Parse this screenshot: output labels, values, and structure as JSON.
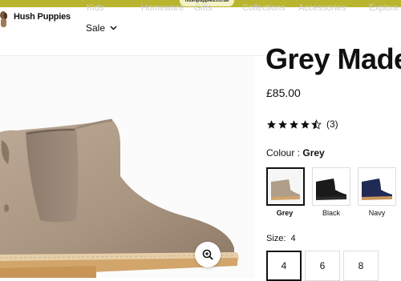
{
  "browser": {
    "url": "hushpuppies.co.uk"
  },
  "header": {
    "brand": "Hush Puppies",
    "nav_ghost": [
      "Kids",
      "Homeware",
      "Gifts",
      "Collections",
      "Accessories",
      "Explore"
    ],
    "sale_label": "Sale"
  },
  "product": {
    "title": "Grey Made",
    "price": "£85.00",
    "rating": {
      "stars": 4.5,
      "count": "(3)"
    },
    "colour": {
      "label": "Colour :",
      "selected": "Grey",
      "options": [
        {
          "name": "Grey",
          "color": "#b09d8a"
        },
        {
          "name": "Black",
          "color": "#1a1a1a"
        },
        {
          "name": "Navy",
          "color": "#1f2a55"
        }
      ]
    },
    "size": {
      "label": "Size:",
      "selected": "4",
      "options": [
        "4",
        "6",
        "8"
      ]
    }
  },
  "colors": {
    "topbar": "#b9b52e",
    "suede": "#b09d8a",
    "sole": "#d2a56b"
  }
}
